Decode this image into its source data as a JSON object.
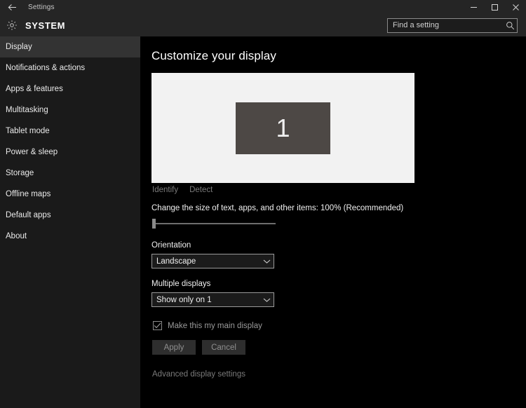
{
  "titlebar": {
    "back_icon": "back-arrow-icon",
    "title": "Settings",
    "minimize_label": "Minimize",
    "maximize_label": "Maximize",
    "close_label": "Close"
  },
  "header": {
    "icon": "gear-icon",
    "title": "SYSTEM",
    "search": {
      "placeholder": "Find a setting",
      "value": "",
      "icon": "search-icon"
    }
  },
  "sidebar": {
    "items": [
      {
        "label": "Display",
        "selected": true
      },
      {
        "label": "Notifications & actions",
        "selected": false
      },
      {
        "label": "Apps & features",
        "selected": false
      },
      {
        "label": "Multitasking",
        "selected": false
      },
      {
        "label": "Tablet mode",
        "selected": false
      },
      {
        "label": "Power & sleep",
        "selected": false
      },
      {
        "label": "Storage",
        "selected": false
      },
      {
        "label": "Offline maps",
        "selected": false
      },
      {
        "label": "Default apps",
        "selected": false
      },
      {
        "label": "About",
        "selected": false
      }
    ]
  },
  "main": {
    "page_title": "Customize your display",
    "preview": {
      "monitor_number": "1",
      "panel_color": "#f2f2f2",
      "monitor_color": "#4d4845"
    },
    "identify_link": "Identify",
    "detect_link": "Detect",
    "scale": {
      "label": "Change the size of text, apps, and other items: 100% (Recommended)",
      "value_percent": 100,
      "slider_position": 0
    },
    "orientation": {
      "label": "Orientation",
      "value": "Landscape",
      "chevron": "chevron-down-icon"
    },
    "multiple_displays": {
      "label": "Multiple displays",
      "value": "Show only on 1",
      "chevron": "chevron-down-icon"
    },
    "main_display_checkbox": {
      "label": "Make this my main display",
      "checked": true,
      "disabled": true
    },
    "apply_button": "Apply",
    "cancel_button": "Cancel",
    "advanced_link": "Advanced display settings"
  }
}
